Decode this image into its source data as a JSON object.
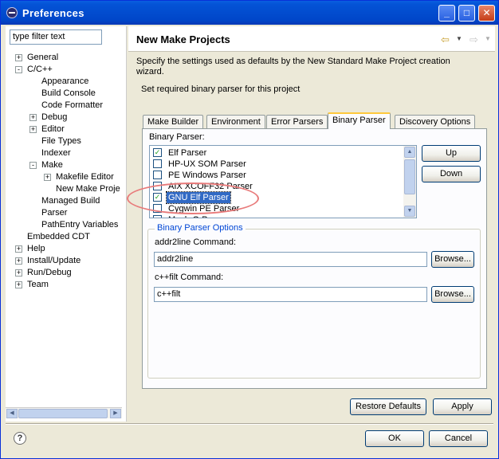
{
  "window": {
    "title": "Preferences"
  },
  "filter": {
    "value": "type filter text"
  },
  "tree": [
    {
      "label": "General",
      "level": 0,
      "expander": "+"
    },
    {
      "label": "C/C++",
      "level": 0,
      "expander": "-"
    },
    {
      "label": "Appearance",
      "level": 1,
      "expander": ""
    },
    {
      "label": "Build Console",
      "level": 1,
      "expander": ""
    },
    {
      "label": "Code Formatter",
      "level": 1,
      "expander": ""
    },
    {
      "label": "Debug",
      "level": 1,
      "expander": "+"
    },
    {
      "label": "Editor",
      "level": 1,
      "expander": "+"
    },
    {
      "label": "File Types",
      "level": 1,
      "expander": ""
    },
    {
      "label": "Indexer",
      "level": 1,
      "expander": ""
    },
    {
      "label": "Make",
      "level": 1,
      "expander": "-"
    },
    {
      "label": "Makefile Editor",
      "level": 2,
      "expander": "+"
    },
    {
      "label": "New Make Proje",
      "level": 2,
      "expander": ""
    },
    {
      "label": "Managed Build",
      "level": 1,
      "expander": ""
    },
    {
      "label": "Parser",
      "level": 1,
      "expander": ""
    },
    {
      "label": "PathEntry Variables",
      "level": 1,
      "expander": ""
    },
    {
      "label": "Embedded CDT",
      "level": 0,
      "expander": ""
    },
    {
      "label": "Help",
      "level": 0,
      "expander": "+"
    },
    {
      "label": "Install/Update",
      "level": 0,
      "expander": "+"
    },
    {
      "label": "Run/Debug",
      "level": 0,
      "expander": "+"
    },
    {
      "label": "Team",
      "level": 0,
      "expander": "+"
    }
  ],
  "page": {
    "title": "New Make Projects",
    "description_line1": "Specify the settings used as defaults by the New Standard Make Project creation",
    "description_line2": "wizard.",
    "subtitle": "Set required binary parser for this project"
  },
  "tabs": [
    {
      "label": "Make Builder",
      "active": false
    },
    {
      "label": "Environment",
      "active": false
    },
    {
      "label": "Error Parsers",
      "active": false
    },
    {
      "label": "Binary Parser",
      "active": true
    },
    {
      "label": "Discovery Options",
      "active": false
    }
  ],
  "binary_parser": {
    "label": "Binary Parser:",
    "items": [
      {
        "label": "Elf Parser",
        "checked": true,
        "selected": false
      },
      {
        "label": "HP-UX SOM Parser",
        "checked": false,
        "selected": false
      },
      {
        "label": "PE Windows Parser",
        "checked": false,
        "selected": false
      },
      {
        "label": "AIX XCOFF32 Parser",
        "checked": false,
        "selected": false
      },
      {
        "label": "GNU Elf Parser",
        "checked": true,
        "selected": true
      },
      {
        "label": "Cygwin PE Parser",
        "checked": false,
        "selected": false
      },
      {
        "label": "Mach-O Parser",
        "checked": false,
        "selected": false
      }
    ],
    "up_label": "Up",
    "down_label": "Down"
  },
  "options": {
    "title": "Binary Parser Options",
    "addr2line_label": "addr2line Command:",
    "addr2line_value": "addr2line",
    "cppfilt_label": "c++filt Command:",
    "cppfilt_value": "c++filt",
    "browse_label": "Browse..."
  },
  "buttons": {
    "restore_defaults": "Restore Defaults",
    "apply": "Apply",
    "ok": "OK",
    "cancel": "Cancel"
  },
  "colors": {
    "titlebar": "#0453d6",
    "selection": "#316ac5",
    "highlight_ellipse": "#e87a7a",
    "group_title": "#0046d5"
  }
}
